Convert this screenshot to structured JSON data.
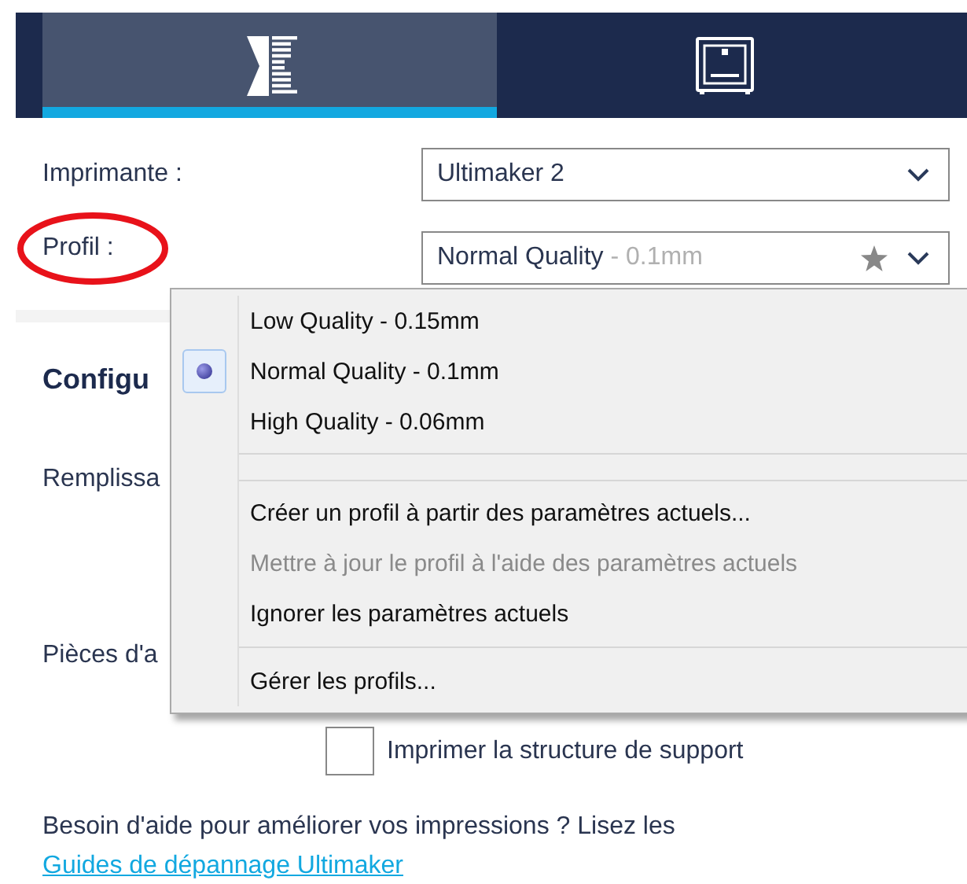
{
  "tabs": [
    {
      "kind": "settings",
      "selected": true
    },
    {
      "kind": "printer",
      "selected": false
    }
  ],
  "printer_field": {
    "label": "Imprimante :",
    "value": "Ultimaker 2"
  },
  "profile_field": {
    "label": "Profil :",
    "value": "Normal Quality",
    "detail": "- 0.1mm",
    "annotated": true
  },
  "section": {
    "heading": "Configu",
    "labels": [
      "Remplissa",
      "Pièces d'a"
    ]
  },
  "profile_menu": [
    {
      "kind": "option",
      "label": "Low Quality - 0.15mm",
      "selected": false
    },
    {
      "kind": "option",
      "label": "Normal Quality - 0.1mm",
      "selected": true
    },
    {
      "kind": "option",
      "label": "High Quality - 0.06mm",
      "selected": false
    },
    {
      "kind": "separator"
    },
    {
      "kind": "action",
      "label": "Créer un profil à partir des paramètres actuels...",
      "disabled": false
    },
    {
      "kind": "action",
      "label": "Mettre à jour le profil à l'aide des paramètres actuels",
      "disabled": true
    },
    {
      "kind": "action",
      "label": "Ignorer les paramètres actuels",
      "disabled": false
    },
    {
      "kind": "rule"
    },
    {
      "kind": "action",
      "label": "Gérer les profils...",
      "disabled": false
    }
  ],
  "support_checkbox": {
    "label": "Imprimer la structure de support",
    "checked": false
  },
  "help": {
    "text": "Besoin d'aide pour améliorer vos impressions ? Lisez les",
    "link": "Guides de dépannage Ultimaker"
  }
}
